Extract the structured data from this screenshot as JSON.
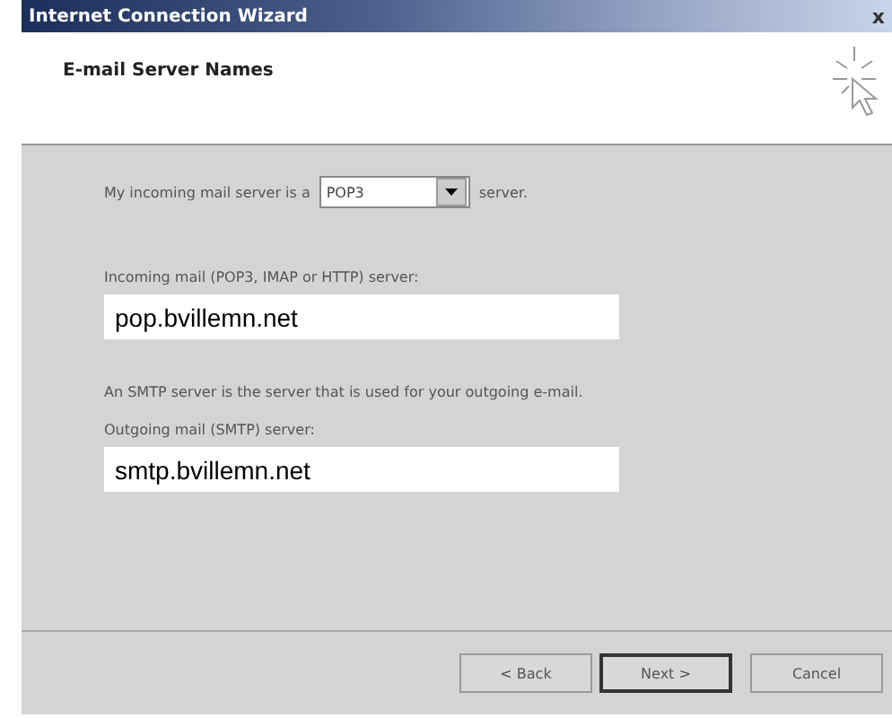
{
  "window": {
    "title": "Internet Connection Wizard",
    "close": "x"
  },
  "header": {
    "title": "E-mail Server Names"
  },
  "server_type": {
    "prefix": "My incoming mail server is a",
    "value": "POP3",
    "suffix": "server."
  },
  "incoming": {
    "label": "Incoming mail (POP3, IMAP or HTTP) server:",
    "value": "pop.bvillemn.net"
  },
  "smtp_note": "An SMTP server is the server that is used for your outgoing e-mail.",
  "outgoing": {
    "label": "Outgoing mail (SMTP) server:",
    "value": "smtp.bvillemn.net"
  },
  "buttons": [
    {
      "label": "< Back",
      "default": false
    },
    {
      "label": "Next >",
      "default": true
    },
    {
      "label": "Cancel",
      "default": false
    }
  ]
}
